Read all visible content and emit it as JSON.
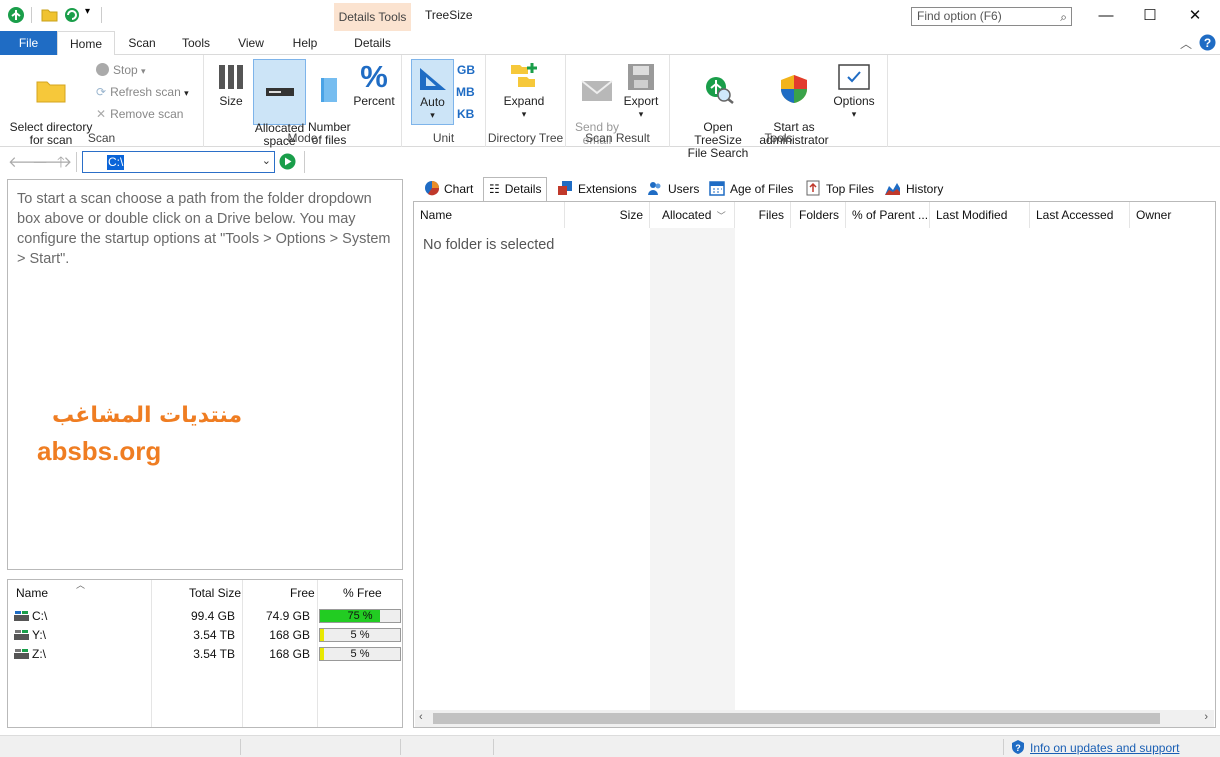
{
  "title_bar": {
    "app_title": "TreeSize",
    "context_tab_header": "Details Tools",
    "find_placeholder": "Find option (F6)"
  },
  "ribbon_tabs": [
    "File",
    "Home",
    "Scan",
    "Tools",
    "View",
    "Help",
    "Details"
  ],
  "ribbon": {
    "scan_group": {
      "label": "Scan",
      "select_directory": "Select directory\nfor scan",
      "stop": "Stop",
      "refresh_scan": "Refresh scan",
      "remove_scan": "Remove scan"
    },
    "mode_group": {
      "label": "Mode",
      "size": "Size",
      "allocated_space": "Allocated\nspace",
      "number_of_files": "Number\nof files",
      "percent": "Percent"
    },
    "unit_group": {
      "label": "Unit",
      "auto": "Auto",
      "gb": "GB",
      "mb": "MB",
      "kb": "KB"
    },
    "directory_tree_group": {
      "label": "Directory Tree",
      "expand": "Expand"
    },
    "scan_result_group": {
      "label": "Scan Result",
      "send_by_email": "Send by\nemail",
      "export": "Export"
    },
    "tools_group": {
      "label": "Tools",
      "open_treesize_file_search": "Open TreeSize\nFile Search",
      "start_as_administrator": "Start as\nadministrator",
      "options": "Options"
    }
  },
  "address": {
    "path": "C:\\"
  },
  "info_text": "To start a scan choose a path from the folder dropdown box above or double click on a Drive below. You may configure the startup options at \"Tools > Options > System > Start\".",
  "watermark": {
    "arabic": "منتديات المشاغب",
    "site": "absbs.org"
  },
  "drives": {
    "headers": [
      "Name",
      "Total Size",
      "Free",
      "% Free"
    ],
    "rows": [
      {
        "name": "C:\\",
        "total": "99.4 GB",
        "free": "74.9 GB",
        "pct": "75 %",
        "pct_value": 75,
        "color": "#22cc22"
      },
      {
        "name": "Y:\\",
        "total": "3.54 TB",
        "free": "168 GB",
        "pct": "5 %",
        "pct_value": 5,
        "color": "#e8e800"
      },
      {
        "name": "Z:\\",
        "total": "3.54 TB",
        "free": "168 GB",
        "pct": "5 %",
        "pct_value": 5,
        "color": "#e8e800"
      }
    ]
  },
  "view_tabs": [
    "Chart",
    "Details",
    "Extensions",
    "Users",
    "Age of Files",
    "Top Files",
    "History"
  ],
  "details": {
    "columns": [
      "Name",
      "Size",
      "Allocated",
      "Files",
      "Folders",
      "% of Parent ...",
      "Last Modified",
      "Last Accessed",
      "Owner"
    ],
    "empty_message": "No folder is selected"
  },
  "status": {
    "link": "Info on updates and support"
  },
  "colors": {
    "file_tab": "#1f6cc4",
    "accent": "#0a64d8",
    "watermark": "#ef7d22"
  }
}
